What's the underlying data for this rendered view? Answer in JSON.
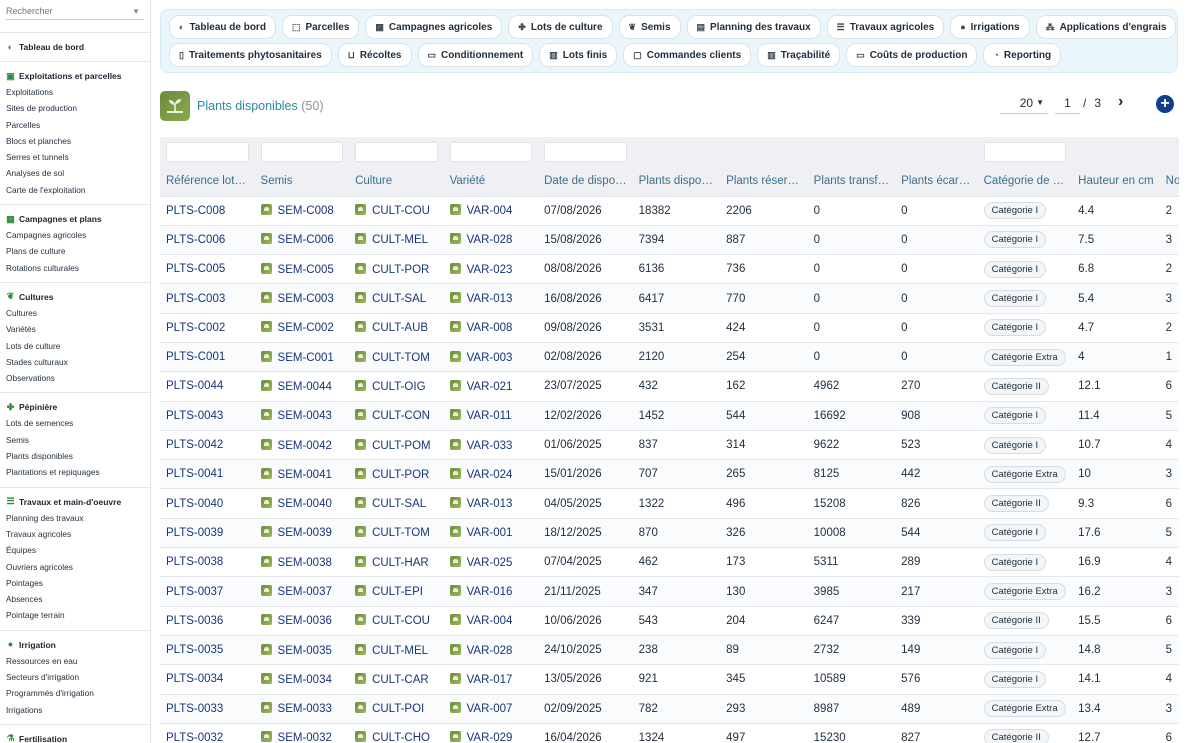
{
  "search": {
    "placeholder": "Rechercher"
  },
  "sidebar": {
    "dashboard": {
      "label": "Tableau de bord"
    },
    "sections": [
      {
        "title": "Exploitations et parcelles",
        "icon": "map-icon",
        "items": [
          "Exploitations",
          "Sites de production",
          "Parcelles",
          "Blocs et planches",
          "Serres et tunnels",
          "Analyses de sol",
          "Carte de l'exploitation"
        ]
      },
      {
        "title": "Campagnes et plans",
        "icon": "calendar-icon",
        "items": [
          "Campagnes agricoles",
          "Plans de culture",
          "Rotations culturales"
        ]
      },
      {
        "title": "Cultures",
        "icon": "leaf-icon",
        "items": [
          "Cultures",
          "Variétés",
          "Lots de culture",
          "Stades culturaux",
          "Observations"
        ]
      },
      {
        "title": "Pépinière",
        "icon": "sprout-icon",
        "items": [
          "Lots de semences",
          "Semis",
          "Plants disponibles",
          "Plantations et repiquages"
        ]
      },
      {
        "title": "Travaux et main-d'oeuvre",
        "icon": "list-icon",
        "items": [
          "Planning des travaux",
          "Travaux agricoles",
          "Équipes",
          "Ouvriers agricoles",
          "Pointages",
          "Absences",
          "Pointage terrain"
        ]
      },
      {
        "title": "Irrigation",
        "icon": "drop-icon",
        "items": [
          "Ressources en eau",
          "Secteurs d'irrigation",
          "Programmés d'irrigation",
          "Irrigations"
        ]
      },
      {
        "title": "Fertilisation",
        "icon": "flask-icon",
        "items": []
      }
    ]
  },
  "topnav": {
    "row1": [
      {
        "label": "Tableau de bord",
        "icon": "gauge-icon"
      },
      {
        "label": "Parcelles",
        "icon": "frame-icon"
      },
      {
        "label": "Campagnes agricoles",
        "icon": "calendar-icon"
      },
      {
        "label": "Lots de culture",
        "icon": "sprout-icon"
      },
      {
        "label": "Semis",
        "icon": "leaf-icon"
      },
      {
        "label": "Planning des travaux",
        "icon": "clipboard-icon"
      },
      {
        "label": "Travaux agricoles",
        "icon": "list-icon"
      },
      {
        "label": "Irrigations",
        "icon": "drop-icon"
      },
      {
        "label": "Applications d'engrais",
        "icon": "spray-icon"
      }
    ],
    "row2": [
      {
        "label": "Traitements phytosanitaires",
        "icon": "spray-bottle-icon"
      },
      {
        "label": "Récoltes",
        "icon": "basket-icon"
      },
      {
        "label": "Conditionnement",
        "icon": "box-icon"
      },
      {
        "label": "Lots finis",
        "icon": "pallet-icon"
      },
      {
        "label": "Commandes clients",
        "icon": "document-icon"
      },
      {
        "label": "Traçabilité",
        "icon": "barcode-icon"
      },
      {
        "label": "Coûts de production",
        "icon": "money-icon"
      },
      {
        "label": "Reporting",
        "icon": "chart-pie-icon"
      }
    ]
  },
  "page": {
    "title": "Plants disponibles",
    "count": "(50)"
  },
  "pager": {
    "page_size": "20",
    "current": "1",
    "slash": "/",
    "total": "3"
  },
  "columns": [
    "Référence lot de plants",
    "Semis",
    "Culture",
    "Variété",
    "Date de disponibilité",
    "Plants disponibles",
    "Plants réservés",
    "Plants transférés",
    "Plants écartés",
    "Catégorie de plants",
    "Hauteur en cm",
    "Nombre de feuilles"
  ],
  "rows": [
    [
      "PLTS-C008",
      "SEM-C008",
      "CULT-COU",
      "VAR-004",
      "07/08/2026",
      "18382",
      "2206",
      "0",
      "0",
      "Catégorie I",
      "4.4",
      "2"
    ],
    [
      "PLTS-C006",
      "SEM-C006",
      "CULT-MEL",
      "VAR-028",
      "15/08/2026",
      "7394",
      "887",
      "0",
      "0",
      "Catégorie I",
      "7.5",
      "3"
    ],
    [
      "PLTS-C005",
      "SEM-C005",
      "CULT-POR",
      "VAR-023",
      "08/08/2026",
      "6136",
      "736",
      "0",
      "0",
      "Catégorie I",
      "6.8",
      "2"
    ],
    [
      "PLTS-C003",
      "SEM-C003",
      "CULT-SAL",
      "VAR-013",
      "16/08/2026",
      "6417",
      "770",
      "0",
      "0",
      "Catégorie I",
      "5.4",
      "3"
    ],
    [
      "PLTS-C002",
      "SEM-C002",
      "CULT-AUB",
      "VAR-008",
      "09/08/2026",
      "3531",
      "424",
      "0",
      "0",
      "Catégorie I",
      "4.7",
      "2"
    ],
    [
      "PLTS-C001",
      "SEM-C001",
      "CULT-TOM",
      "VAR-003",
      "02/08/2026",
      "2120",
      "254",
      "0",
      "0",
      "Catégorie Extra",
      "4",
      "1"
    ],
    [
      "PLTS-0044",
      "SEM-0044",
      "CULT-OIG",
      "VAR-021",
      "23/07/2025",
      "432",
      "162",
      "4962",
      "270",
      "Catégorie II",
      "12.1",
      "6"
    ],
    [
      "PLTS-0043",
      "SEM-0043",
      "CULT-CON",
      "VAR-011",
      "12/02/2026",
      "1452",
      "544",
      "16692",
      "908",
      "Catégorie I",
      "11.4",
      "5"
    ],
    [
      "PLTS-0042",
      "SEM-0042",
      "CULT-POM",
      "VAR-033",
      "01/06/2025",
      "837",
      "314",
      "9622",
      "523",
      "Catégorie I",
      "10.7",
      "4"
    ],
    [
      "PLTS-0041",
      "SEM-0041",
      "CULT-POR",
      "VAR-024",
      "15/01/2026",
      "707",
      "265",
      "8125",
      "442",
      "Catégorie Extra",
      "10",
      "3"
    ],
    [
      "PLTS-0040",
      "SEM-0040",
      "CULT-SAL",
      "VAR-013",
      "04/05/2025",
      "1322",
      "496",
      "15208",
      "826",
      "Catégorie II",
      "9.3",
      "6"
    ],
    [
      "PLTS-0039",
      "SEM-0039",
      "CULT-TOM",
      "VAR-001",
      "18/12/2025",
      "870",
      "326",
      "10008",
      "544",
      "Catégorie I",
      "17.6",
      "5"
    ],
    [
      "PLTS-0038",
      "SEM-0038",
      "CULT-HAR",
      "VAR-025",
      "07/04/2025",
      "462",
      "173",
      "5311",
      "289",
      "Catégorie I",
      "16.9",
      "4"
    ],
    [
      "PLTS-0037",
      "SEM-0037",
      "CULT-EPI",
      "VAR-016",
      "21/11/2025",
      "347",
      "130",
      "3985",
      "217",
      "Catégorie Extra",
      "16.2",
      "3"
    ],
    [
      "PLTS-0036",
      "SEM-0036",
      "CULT-COU",
      "VAR-004",
      "10/06/2026",
      "543",
      "204",
      "6247",
      "339",
      "Catégorie II",
      "15.5",
      "6"
    ],
    [
      "PLTS-0035",
      "SEM-0035",
      "CULT-MEL",
      "VAR-028",
      "24/10/2025",
      "238",
      "89",
      "2732",
      "149",
      "Catégorie I",
      "14.8",
      "5"
    ],
    [
      "PLTS-0034",
      "SEM-0034",
      "CULT-CAR",
      "VAR-017",
      "13/05/2026",
      "921",
      "345",
      "10589",
      "576",
      "Catégorie I",
      "14.1",
      "4"
    ],
    [
      "PLTS-0033",
      "SEM-0033",
      "CULT-POI",
      "VAR-007",
      "02/09/2025",
      "782",
      "293",
      "8987",
      "489",
      "Catégorie Extra",
      "13.4",
      "3"
    ],
    [
      "PLTS-0032",
      "SEM-0032",
      "CULT-CHO",
      "VAR-029",
      "16/04/2026",
      "1324",
      "497",
      "15230",
      "827",
      "Catégorie II",
      "12.7",
      "6"
    ]
  ]
}
